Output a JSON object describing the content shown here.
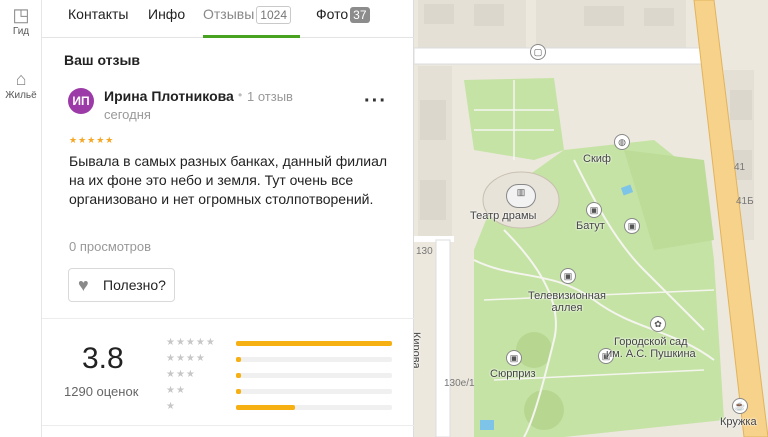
{
  "rail": {
    "items": [
      {
        "label": "Гид",
        "icon": "guide-icon"
      },
      {
        "label": "Жильё",
        "icon": "housing-icon"
      }
    ]
  },
  "tabs": [
    {
      "label": "Контакты"
    },
    {
      "label": "Инфо"
    },
    {
      "label": "Отзывы",
      "count": "1024"
    },
    {
      "label": "Фото",
      "count": "37"
    }
  ],
  "review": {
    "section_title": "Ваш отзыв",
    "avatar_initials": "ИП",
    "author": "Ирина Плотникова",
    "author_reviews": "1 отзыв",
    "date": "сегодня",
    "rating_stars": 5,
    "text": "Бывала в самых разных банках, данный филиал на их фоне это небо и земля. Тут очень все организовано и нет огромных столпотворений.",
    "views": "0 просмотров",
    "useful_label": "Полезно?"
  },
  "summary": {
    "rating": "3.8",
    "ratings_count": "1290 оценок",
    "distribution": [
      {
        "stars": 5,
        "fraction": 1.0
      },
      {
        "stars": 4,
        "fraction": 0.03
      },
      {
        "stars": 3,
        "fraction": 0.03
      },
      {
        "stars": 2,
        "fraction": 0.03
      },
      {
        "stars": 1,
        "fraction": 0.38
      }
    ]
  },
  "map": {
    "labels": {
      "theatre": "Театр драмы",
      "skif": "Скиф",
      "batut": "Батут",
      "tv_alley": "Телевизионная\nаллея",
      "park": "Городской сад\nим. А.С. Пушкина",
      "surprise": "Сюрприз",
      "kirova": "Кирова",
      "kruzhka": "Кружка"
    },
    "numbers": {
      "n130": "130",
      "n130e": "130е/1",
      "n41": "41",
      "n41b": "41Б"
    },
    "colors": {
      "park": "#c5e3a4",
      "road_major": "#f7d28a",
      "road_border": "#e2b35c",
      "building": "#dcd7cc",
      "water": "#7ec3e8"
    }
  }
}
